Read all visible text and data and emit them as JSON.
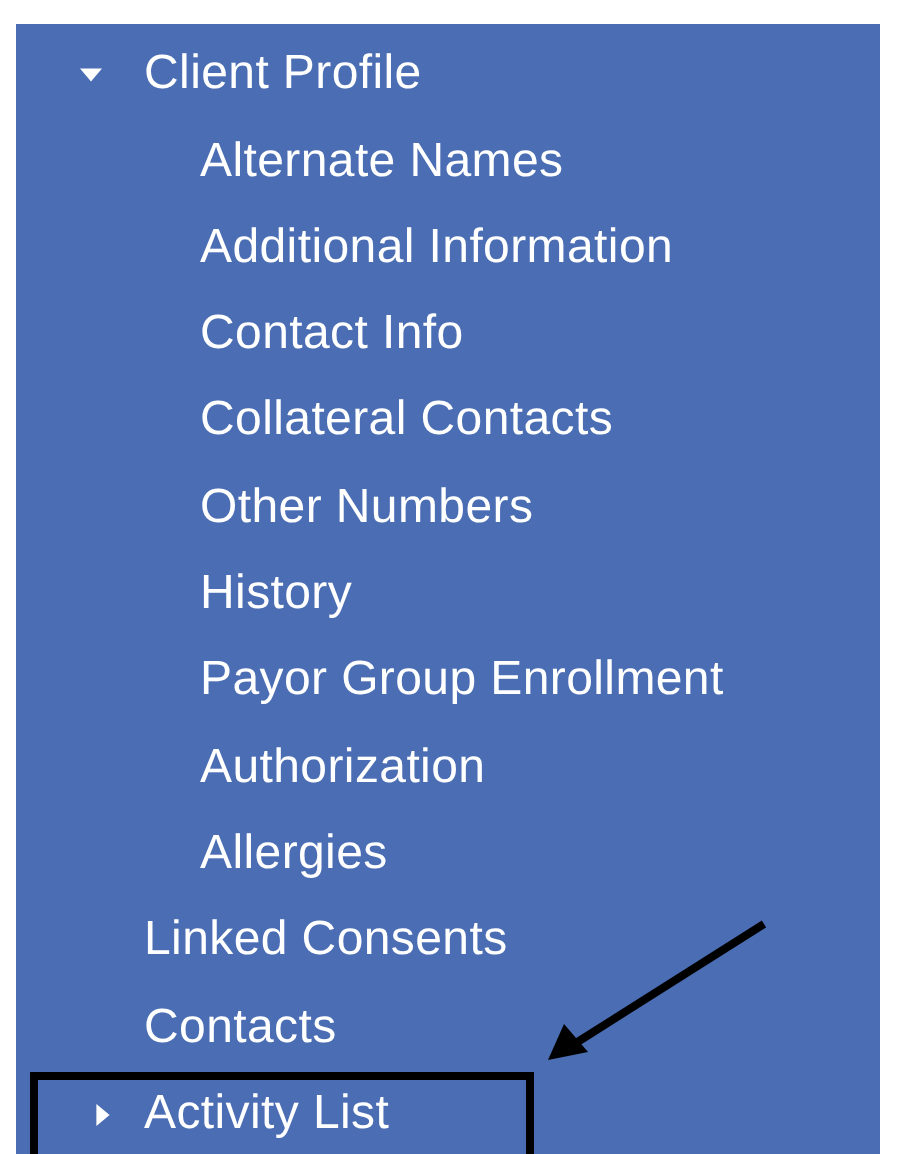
{
  "nav": {
    "items": [
      {
        "label": "Client Profile",
        "expanded": true,
        "highlighted": false,
        "children": [
          {
            "label": "Alternate Names",
            "highlighted": false
          },
          {
            "label": "Additional Information",
            "highlighted": false
          },
          {
            "label": "Contact Info",
            "highlighted": false
          },
          {
            "label": "Collateral Contacts",
            "highlighted": false
          },
          {
            "label": "Other Numbers",
            "highlighted": false
          },
          {
            "label": "History",
            "highlighted": false
          },
          {
            "label": "Payor Group Enrollment",
            "highlighted": false
          },
          {
            "label": "Authorization",
            "highlighted": false
          },
          {
            "label": "Allergies",
            "highlighted": false
          }
        ]
      },
      {
        "label": "Linked Consents",
        "highlighted": false
      },
      {
        "label": "Contacts",
        "highlighted": false
      },
      {
        "label": "Activity List",
        "expanded": false,
        "highlighted": true
      }
    ]
  }
}
